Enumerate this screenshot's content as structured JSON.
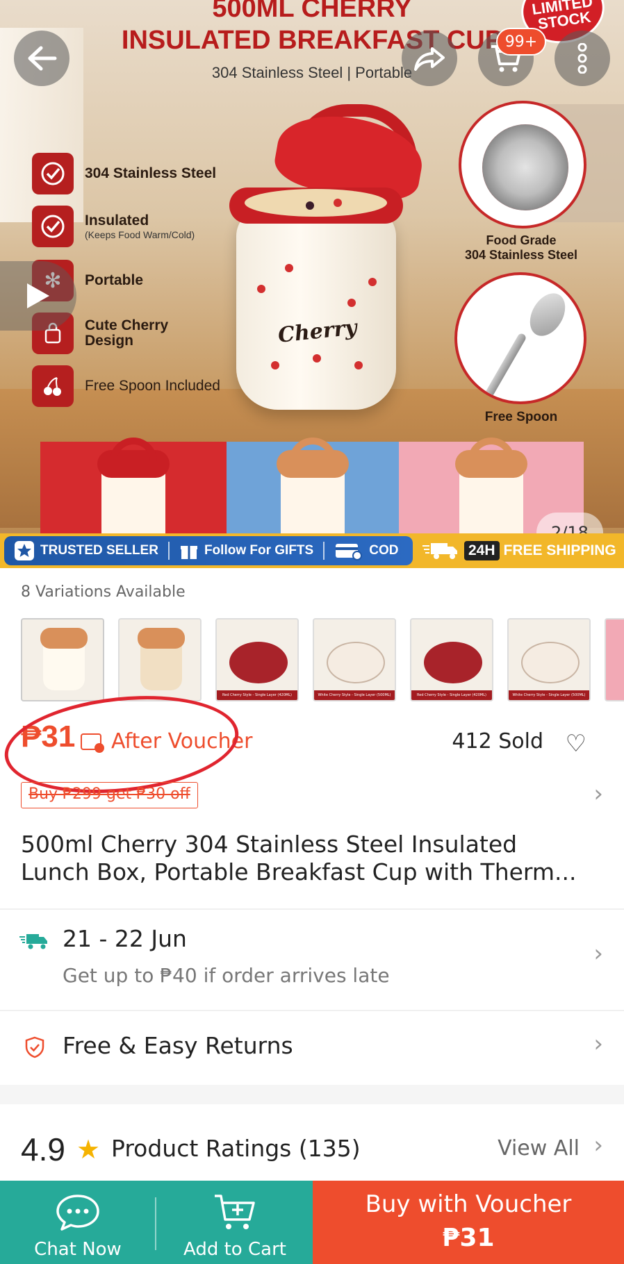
{
  "hero": {
    "title_line1": "500ML CHERRY",
    "title_line2": "INSULATED BREAKFAST CUP",
    "subtitle": "304 Stainless Steel | Portable",
    "stock_badge": "LIMITED STOCK",
    "cart_count": "99+",
    "features": [
      {
        "label": "304 Stainless Steel",
        "note": "",
        "icon": "check-icon"
      },
      {
        "label": "Insulated",
        "note": "(Keeps Food Warm/Cold)",
        "icon": "check-icon"
      },
      {
        "label": "Portable",
        "note": "",
        "icon": "snowflake-icon"
      },
      {
        "label": "Cute Cherry Design",
        "note": "",
        "icon": "bag-icon"
      },
      {
        "label": "Free Spoon Included",
        "note": "",
        "icon": "cherry-icon"
      }
    ],
    "jar_text": "Cherry",
    "bowl_caption_l1": "Food Grade",
    "bowl_caption_l2": "304 Stainless Steel",
    "spoon_caption": "Free Spoon",
    "pager": "2/18",
    "trust": {
      "seller": "TRUSTED SELLER",
      "gifts": "Follow For GIFTS",
      "cod": "COD",
      "ship_badge": "24H",
      "ship_text": "FREE SHIPPING"
    }
  },
  "variations": {
    "label": "8 Variations Available",
    "captions": [
      "Red Cherry Style - Single Layer (420ML)",
      "White Cherry Style - Single Layer (500ML)",
      "Red Cherry Style - Single Layer (420ML)",
      "White Cherry Style - Single Layer (500ML)"
    ]
  },
  "price": {
    "value": "₱31",
    "after_voucher": "After Voucher",
    "sold": "412 Sold",
    "promo": "Buy ₱299 get ₱30 off"
  },
  "product": {
    "title_l1": "500ml Cherry 304 Stainless Steel Insulated",
    "title_l2": "Lunch Box, Portable Breakfast Cup with Therm..."
  },
  "delivery": {
    "date": "21 - 22 Jun",
    "note": "Get up to ₱40 if order arrives late"
  },
  "returns": {
    "label": "Free & Easy Returns"
  },
  "ratings": {
    "score": "4.9",
    "label": "Product Ratings (135)",
    "view_all": "View All"
  },
  "bottom": {
    "chat": "Chat Now",
    "cart": "Add to Cart",
    "buy_l1": "Buy with Voucher",
    "buy_l2": "₱31"
  },
  "colors": {
    "brand": "#ee4d2d",
    "teal": "#26aa99",
    "product_red": "#c62828"
  }
}
